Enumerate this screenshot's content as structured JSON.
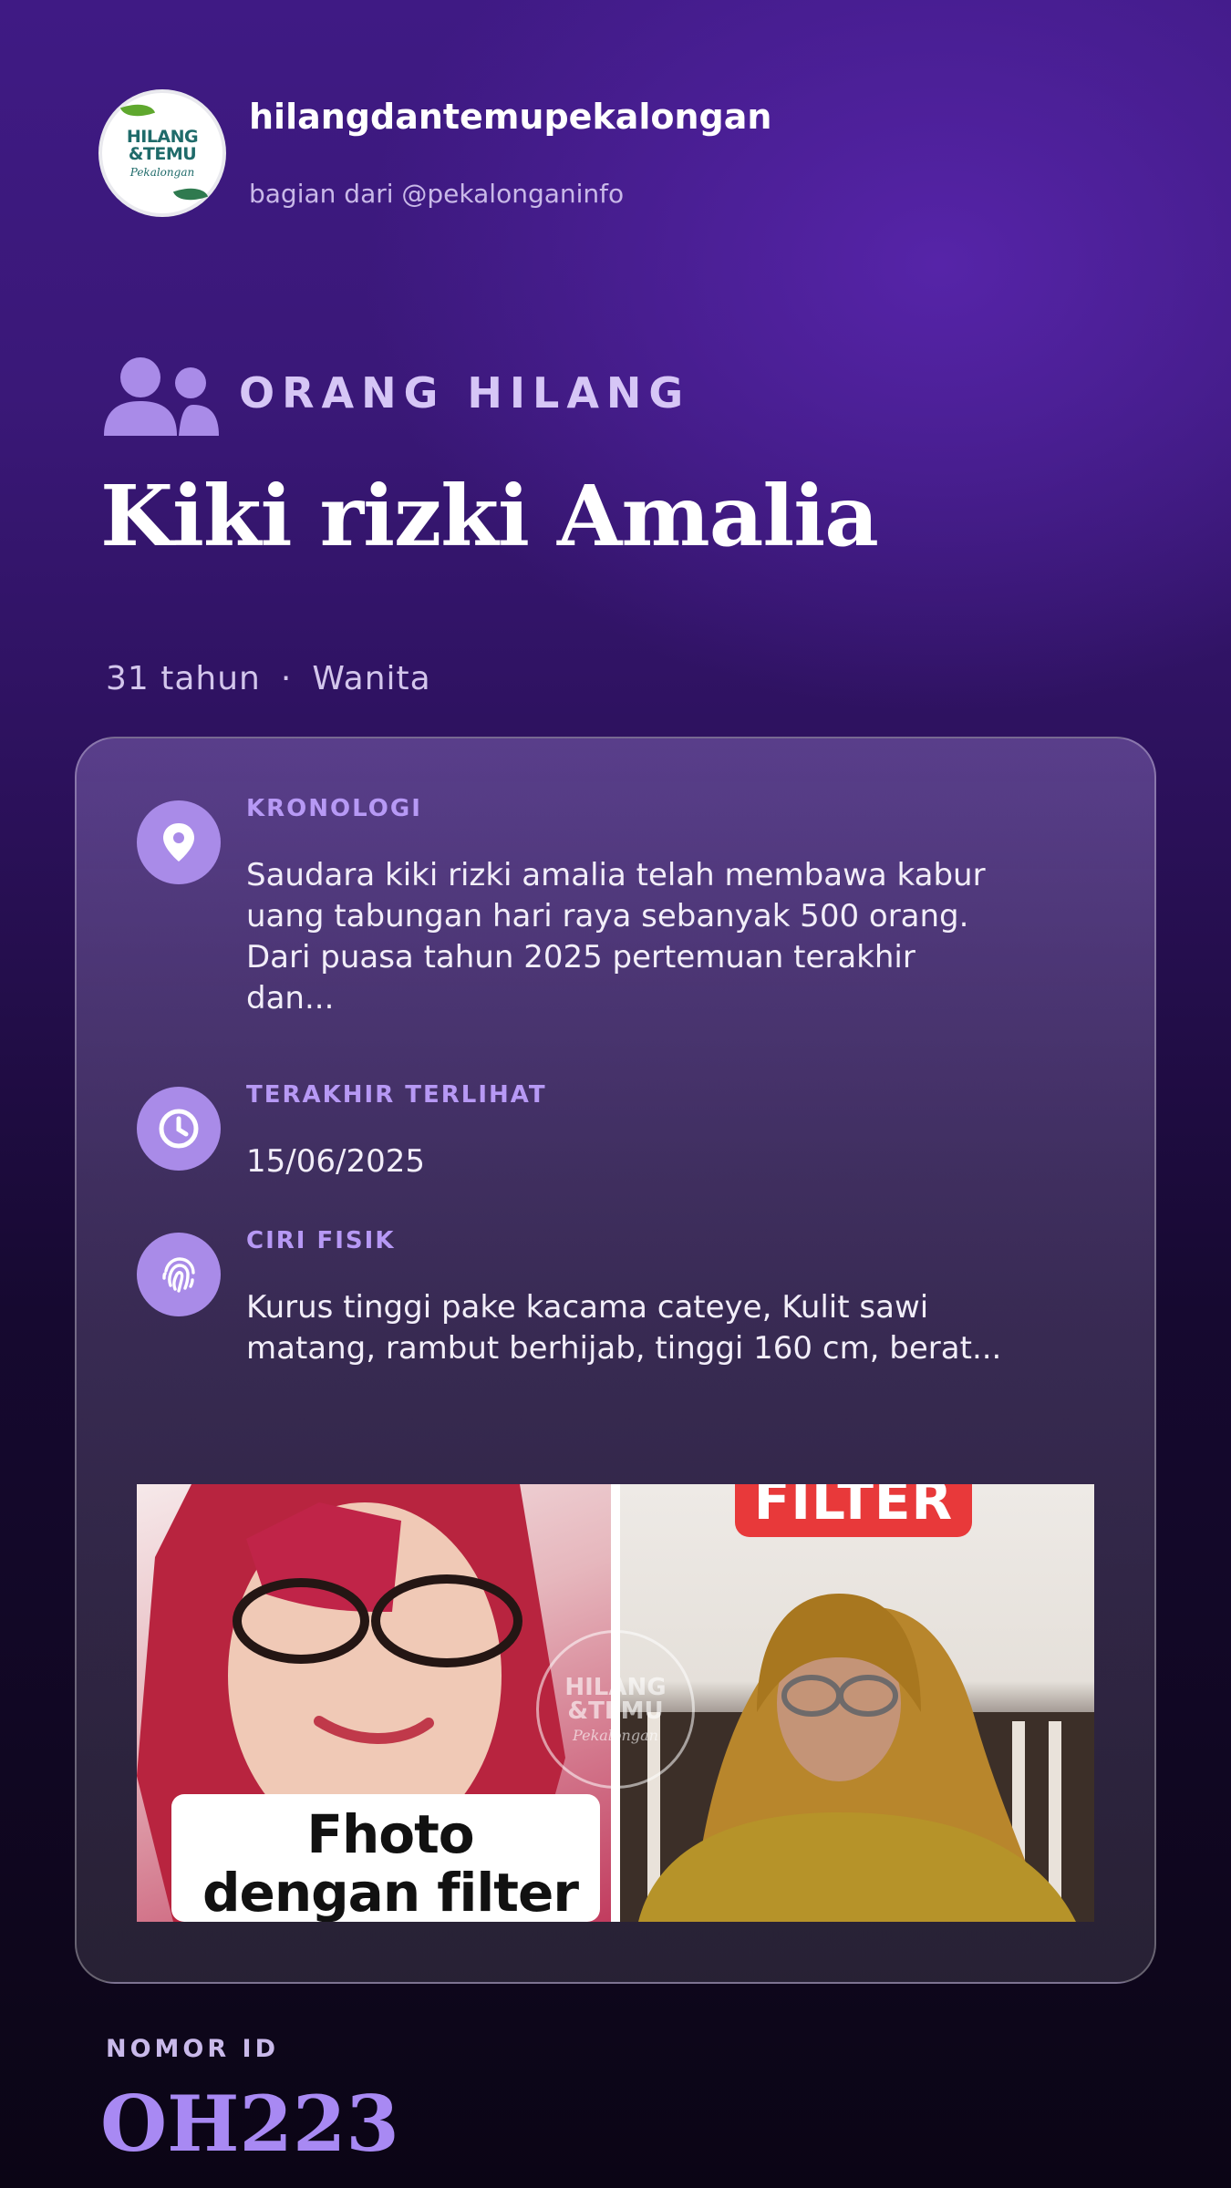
{
  "header": {
    "logo_line1": "HILANG",
    "logo_line2": "&TEMU",
    "logo_sub": "Pekalongan",
    "account_name": "hilangdantemupekalongan",
    "account_sub": "bagian dari @pekalonganinfo"
  },
  "category": {
    "icon": "people-icon",
    "label": "ORANG HILANG"
  },
  "person": {
    "name": "Kiki rizki Amalia",
    "age": "31 tahun",
    "separator": "·",
    "gender": "Wanita"
  },
  "card": {
    "sections": [
      {
        "icon": "location-pin-icon",
        "label": "KRONOLOGI",
        "text": "Saudara kiki rizki amalia telah membawa kabur uang tabungan hari raya sebanyak 500 orang. Dari puasa tahun 2025 pertemuan terakhir dan..."
      },
      {
        "icon": "clock-icon",
        "label": "TERAKHIR TERLIHAT",
        "text": "15/06/2025"
      },
      {
        "icon": "fingerprint-icon",
        "label": "CIRI FISIK",
        "text": "Kurus tinggi pake kacama cateye, Kulit sawi matang, rambut berhijab, tinggi 160 cm, berat..."
      }
    ],
    "photo": {
      "caption": "Fhoto dengan filter",
      "badge": "FILTER",
      "watermark_line1": "HILANG",
      "watermark_line2": "&TEMU",
      "watermark_sub": "Pekalongan"
    }
  },
  "footer": {
    "id_label": "NOMOR ID",
    "id_value": "OH223"
  },
  "colors": {
    "accent": "#a98be8",
    "label": "#b799f5",
    "id_value": "#a889f3",
    "background_top": "#3f1a84",
    "background_bottom": "#0b0515"
  }
}
